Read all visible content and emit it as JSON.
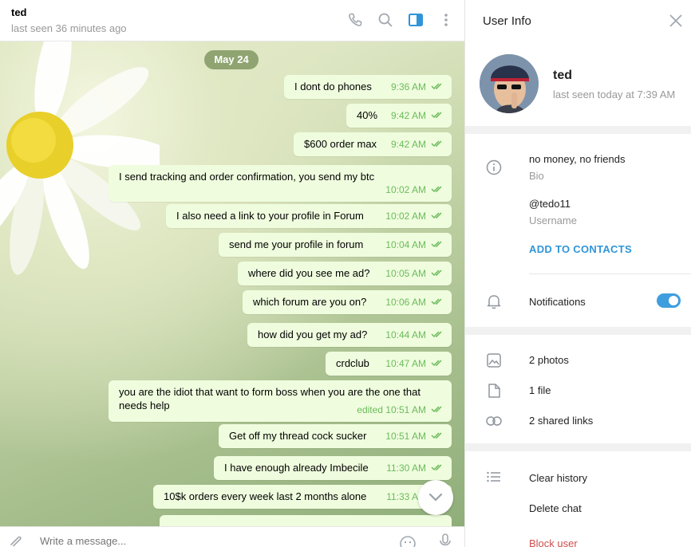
{
  "chat": {
    "title": "ted",
    "status": "last seen 36 minutes ago",
    "date_pill": "May 24",
    "composer_placeholder": "Write a message...",
    "messages": [
      {
        "text": "I dont do phones",
        "time": "9:36 AM"
      },
      {
        "text": "40%",
        "time": "9:42 AM"
      },
      {
        "text": "$600 order max",
        "time": "9:42 AM"
      },
      {
        "text": "I send tracking and order confirmation, you send my btc",
        "time": "10:02 AM"
      },
      {
        "text": "I also need a link to your profile in Forum",
        "time": "10:02 AM"
      },
      {
        "text": "send me your profile in forum",
        "time": "10:04 AM"
      },
      {
        "text": "where did you see me ad?",
        "time": "10:05 AM"
      },
      {
        "text": "which forum are you on?",
        "time": "10:06 AM"
      },
      {
        "text": "how did you get my ad?",
        "time": "10:44 AM"
      },
      {
        "text": "crdclub",
        "time": "10:47 AM"
      },
      {
        "text": "you are the idiot that want to form boss when you are the one that needs help",
        "time": "edited 10:51 AM"
      },
      {
        "text": "Get off my thread cock sucker",
        "time": "10:51 AM"
      },
      {
        "text": "I have enough already Imbecile",
        "time": "11:30 AM"
      },
      {
        "text": "10$k orders every week last 2 months alone",
        "time": "11:33 AM"
      }
    ],
    "icons": {
      "call": "phone-icon",
      "search": "search-icon",
      "sidebar": "sidebar-toggle-icon",
      "more": "more-vertical-icon",
      "attach": "paperclip-icon",
      "emoji": "emoji-icon",
      "mic": "microphone-icon",
      "scroll": "chevron-down-icon"
    }
  },
  "info": {
    "title": "User Info",
    "name": "ted",
    "last_seen": "last seen today at 7:39 AM",
    "bio": "no money, no friends",
    "bio_label": "Bio",
    "username": "@tedo11",
    "username_label": "Username",
    "add_contacts": "ADD TO CONTACTS",
    "notifications": "Notifications",
    "notifications_on": true,
    "media": {
      "photos": "2 photos",
      "files": "1 file",
      "links": "2 shared links"
    },
    "actions": {
      "clear": "Clear history",
      "delete": "Delete chat",
      "block": "Block user"
    }
  },
  "colors": {
    "bubble_out": "#effdde",
    "time_green": "#6cba5c",
    "accent_blue": "#2f95d8",
    "danger_red": "#d14e4e"
  }
}
